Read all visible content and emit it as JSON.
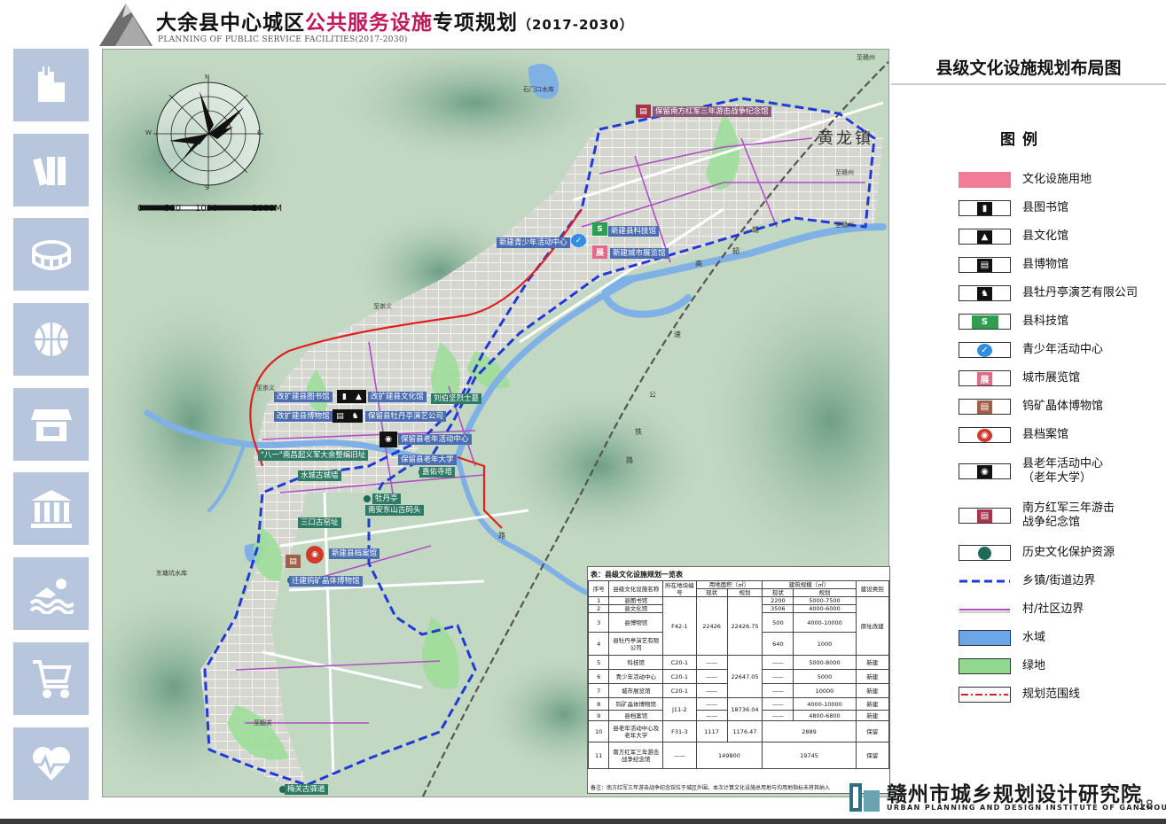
{
  "header": {
    "title_part1": "大余县中心城区",
    "title_highlight": "公共服务设施",
    "title_part2": "专项规划",
    "title_years": "（2017-2030）",
    "subtitle_en": "PLANNING OF PUBLIC SERVICE FACILITIES(2017-2030)"
  },
  "sidebar": {
    "items": [
      {
        "icon": "hospital-icon"
      },
      {
        "icon": "books-icon"
      },
      {
        "icon": "stadium-icon"
      },
      {
        "icon": "basketball-icon"
      },
      {
        "icon": "shop-icon"
      },
      {
        "icon": "bank-icon"
      },
      {
        "icon": "swimming-icon"
      },
      {
        "icon": "cart-icon"
      },
      {
        "icon": "heart-icon"
      }
    ]
  },
  "map": {
    "compass": {
      "n": "N",
      "e": "E",
      "s": "S",
      "w": "W"
    },
    "scale": {
      "ticks": [
        "0",
        "500",
        "1000",
        "2000M"
      ]
    },
    "big_place": "黄龙镇",
    "places": {
      "reservoir_n": "石门口水库",
      "reservoir_w": "东塘坑水库",
      "road_ne": "至赣州",
      "road_nw": "至崇义",
      "road_w": "至崇义",
      "road_e": "至赣州",
      "road_ne2": "至赣州",
      "road_sw": "至韶关"
    },
    "rail_chars": [
      "赣",
      "韶",
      "铁",
      "路",
      "高",
      "速",
      "公",
      "路"
    ],
    "labels": {
      "martyrs": "保留南方红军三年游击战争纪念馆",
      "youth_center": "新建青少年活动中心",
      "science_museum": "新建县科技馆",
      "exhibition_hall": "新建城市展览馆",
      "library": "改扩建县图书馆",
      "culture_hall": "改扩建县文化馆",
      "museum": "改扩建县博物馆",
      "peony": "保留县牡丹亭演艺公司",
      "liu_tomb": "刘伯坚烈士墓",
      "elderly_center": "保留县老年活动中心",
      "elderly_univ": "保留县老年大学",
      "bayi": "\"八一\"南昌起义军大余整编旧址",
      "gate_site": "嘉佑寺塔",
      "wall_site": "水城古城墙",
      "mudan": "牡丹亭",
      "nanan": "南安东山古码头",
      "sankou": "三口古窑址",
      "archives": "新建县档案馆",
      "tungsten": "迁建钨矿晶体博物馆",
      "meiguan": "梅关古驿道"
    }
  },
  "panel": {
    "title": "县级文化设施规划布局图",
    "legend_heading": "图例",
    "legend": [
      {
        "label": "文化设施用地",
        "icon": "culture-land-swatch",
        "color": "#f07d95"
      },
      {
        "label": "县图书馆",
        "icon": "library-icon",
        "color": "#111111"
      },
      {
        "label": "县文化馆",
        "icon": "culture-hall-icon",
        "color": "#111111"
      },
      {
        "label": "县博物馆",
        "icon": "museum-icon",
        "color": "#111111"
      },
      {
        "label": "县牡丹亭演艺有限公司",
        "icon": "theater-icon",
        "color": "#111111"
      },
      {
        "label": "县科技馆",
        "icon": "science-museum-icon",
        "color": "#2e9e4f"
      },
      {
        "label": "青少年活动中心",
        "icon": "youth-center-icon",
        "color": "#2f8ee0"
      },
      {
        "label": "城市展览馆",
        "icon": "exhibition-icon",
        "color": "#e26a86",
        "text": "展"
      },
      {
        "label": "钨矿晶体博物馆",
        "icon": "tungsten-museum-icon",
        "color": "#a0604a"
      },
      {
        "label": "县档案馆",
        "icon": "archives-icon",
        "color": "#d13a2a"
      },
      {
        "label": "县老年活动中心\n（老年大学）",
        "icon": "elderly-center-icon",
        "color": "#111111"
      },
      {
        "label": "南方红军三年游击\n战争纪念馆",
        "icon": "memorial-icon",
        "color": "#a8334a"
      },
      {
        "label": "历史文化保护资源",
        "icon": "heritage-dot-icon",
        "color": "#1e6a5a"
      },
      {
        "label": "乡镇/街道边界",
        "icon": "town-boundary-line",
        "color": "#1f3ad6"
      },
      {
        "label": "村/社区边界",
        "icon": "village-boundary-line",
        "color": "#b04fc4"
      },
      {
        "label": "水域",
        "icon": "water-swatch",
        "color": "#6aa6e8"
      },
      {
        "label": "绿地",
        "icon": "green-swatch",
        "color": "#8fd88e"
      },
      {
        "label": "规划范围线",
        "icon": "planning-boundary-line",
        "color": "#e02020"
      }
    ]
  },
  "table": {
    "caption": "表：县级文化设施规划一览表",
    "headers": {
      "no": "序号",
      "name": "县级文化设施名称",
      "plot": "所在地块编号",
      "land_area": "用地面积（㎡）",
      "build_area": "建筑规模（㎡）",
      "current": "现状",
      "planned": "规划",
      "type": "建设类别"
    },
    "rows": [
      {
        "no": "1",
        "name": "县图书馆",
        "build_cur": "2200",
        "build_plan": "5000-7500"
      },
      {
        "no": "2",
        "name": "县文化馆",
        "build_cur": "3506",
        "build_plan": "4000-6000"
      },
      {
        "no": "3",
        "name": "县博物馆",
        "build_cur": "500",
        "build_plan": "4000-10000"
      },
      {
        "no": "4",
        "name": "县牡丹亭演艺有限公司",
        "build_cur": "640",
        "build_plan": "1000"
      },
      {
        "no": "5",
        "name": "科技馆",
        "plot": "C20-1",
        "land_cur": "——",
        "build_cur": "——",
        "build_plan": "5000-8000",
        "type": "新建"
      },
      {
        "no": "6",
        "name": "青少年活动中心",
        "plot": "C20-1",
        "land_cur": "——",
        "build_cur": "——",
        "build_plan": "5000",
        "type": "新建"
      },
      {
        "no": "7",
        "name": "城市展览馆",
        "plot": "C20-1",
        "land_cur": "——",
        "build_cur": "——",
        "build_plan": "10000",
        "type": "新建"
      },
      {
        "no": "8",
        "name": "钨矿晶体博物馆",
        "land_cur": "——",
        "build_cur": "——",
        "build_plan": "4000-10000",
        "type": "新建"
      },
      {
        "no": "9",
        "name": "县档案馆",
        "land_cur": "——",
        "build_cur": "——",
        "build_plan": "4800-6800",
        "type": "新建"
      },
      {
        "no": "10",
        "name": "县老年活动中心及老年大学",
        "plot": "F31-3",
        "land_cur": "1117",
        "land_plan": "1176.47",
        "build": "2889",
        "type": "保留"
      },
      {
        "no": "11",
        "name": "南方红军三年游击战争纪念馆",
        "plot": "——",
        "land": "149800",
        "build": "19745",
        "type": "保留"
      }
    ],
    "merged": {
      "plot_1_4": "F42-1",
      "land_cur_1_4": "22426",
      "land_plan_1_4": "22426.75",
      "type_1_4": "原址改建",
      "land_plan_5_7": "22647.05",
      "plot_8_9": "J11-2",
      "land_plan_8_9": "18736.04"
    },
    "note": "备注：南方红军三年游击战争纪念馆位于城区外围，本次计算文化设施总用地与均用地指标未将其纳入"
  },
  "footer": {
    "institute": "赣州市城乡规划设计研究院",
    "institute_en": "URBAN PLANNING AND DESIGN INSTITUTE OF GANZHOU",
    "page": "18"
  }
}
